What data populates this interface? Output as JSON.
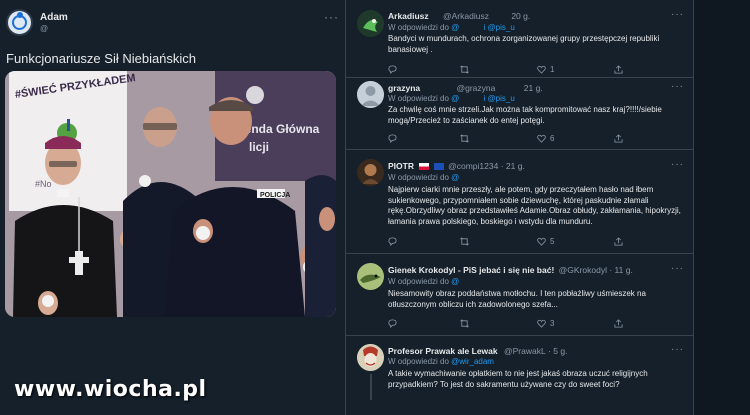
{
  "original": {
    "author_name": "Adam",
    "author_handle": "@",
    "more_label": "···",
    "text": "Funkcjonariusze Sił Niebiańskich",
    "photo": {
      "banner_left": "#ŚWIEĆ PRZYKŁADEM",
      "banner_left_sub": "#No",
      "banner_right_line1": "Komenda Główna",
      "banner_right_line2": "licji",
      "badge_text": "POLICJA"
    }
  },
  "watermark": "www.wiocha.pl",
  "replies": [
    {
      "name": "Arkadiusz",
      "handle": "@Arkadiusz",
      "time": "20 g.",
      "in_reply_prefix": "W odpowiedzi do",
      "mentions": [
        "@",
        "i @pis_u"
      ],
      "text": "Bandyci w mundurach, ochrona zorganizowanej grupy przestępczej republiki banasiowej .",
      "actions": {
        "reply": "",
        "retweet": "",
        "like": "1",
        "share": ""
      }
    },
    {
      "name": "grazyna",
      "handle": "@grazyna",
      "time": "21 g.",
      "in_reply_prefix": "W odpowiedzi do",
      "mentions": [
        "@",
        "i @pis_u"
      ],
      "text": "Za chwilę coś mnie strzeli.Jak można tak kompromitować nasz kraj?!!!!/siebie mogą/Przecież to zaścianek do entej potęgi.",
      "actions": {
        "reply": "",
        "retweet": "",
        "like": "6",
        "share": ""
      }
    },
    {
      "name": "PIOTR",
      "handle": "@compi1234",
      "time": "· 21 g.",
      "in_reply_prefix": "W odpowiedzi do",
      "mentions": [
        "@"
      ],
      "text": "Najpierw ciarki mnie przeszły, ale potem, gdy przeczytałem hasło nad łbem sukienkowego, przypomniałem sobie dziewuchę, której paskudnie złamali rękę.Obrzydliwy obraz przedstawiłeś Adamie.Obraz obłudy, zakłamania, hipokryzji, łamania prawa polskiego, boskiego i wstydu dla munduru.",
      "actions": {
        "reply": "",
        "retweet": "",
        "like": "5",
        "share": ""
      }
    },
    {
      "name": "Gienek Krokodyl - PiS jebać i się nie bać!",
      "handle": "@GKrokodyl",
      "time": "· 11 g.",
      "in_reply_prefix": "W odpowiedzi do",
      "mentions": [
        "@"
      ],
      "text": "Niesamowity obraz poddaństwa motłochu. I ten pobłażliwy uśmieszek na otłuszczonym obliczu ich zadowolonego szefa...",
      "actions": {
        "reply": "",
        "retweet": "",
        "like": "3",
        "share": ""
      }
    },
    {
      "name": "Profesor Prawak ale Lewak",
      "handle": "@PrawakL",
      "time": "· 5 g.",
      "in_reply_prefix": "W odpowiedzi do",
      "mentions": [
        "@wir_adam"
      ],
      "text": "A takie wymachiwanie opłatkiem to nie jest jakaś obraza uczuć religijnych przypadkiem? To jest do sakramentu używane czy do sweet foci?",
      "actions": {
        "reply": "",
        "retweet": "",
        "like": "",
        "share": ""
      }
    }
  ],
  "icons": {
    "reply": "reply-icon",
    "retweet": "retweet-icon",
    "like": "heart-icon",
    "share": "share-icon"
  },
  "colors": {
    "background": "#15202b",
    "mention": "#1d9bf0",
    "muted": "#8b98a5",
    "text": "#e7e9ea",
    "border": "#38444d"
  }
}
